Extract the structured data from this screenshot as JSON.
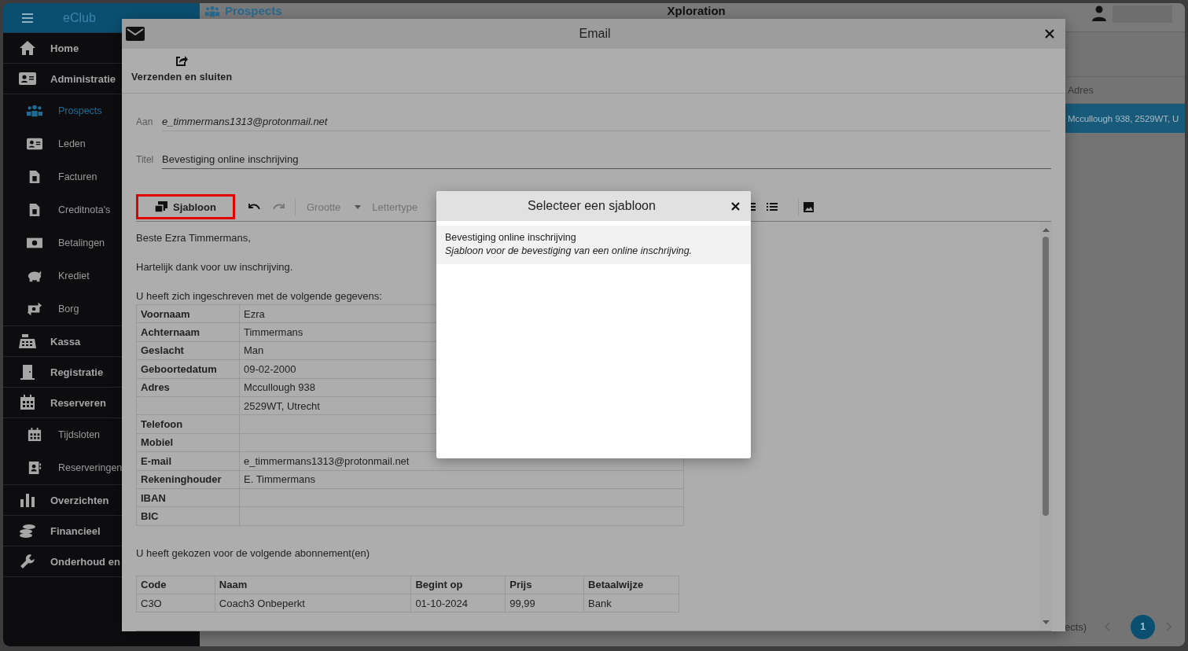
{
  "app": {
    "name": "eClub"
  },
  "sidebar": {
    "items": [
      {
        "label": "Home",
        "selected": false
      },
      {
        "label": "Administratie",
        "selected": false,
        "children": [
          {
            "label": "Prospects",
            "selected": true
          },
          {
            "label": "Leden",
            "selected": false
          },
          {
            "label": "Facturen",
            "selected": false
          },
          {
            "label": "Creditnota's",
            "selected": false
          },
          {
            "label": "Betalingen",
            "selected": false
          },
          {
            "label": "Krediet",
            "selected": false
          },
          {
            "label": "Borg",
            "selected": false
          }
        ]
      },
      {
        "label": "Kassa",
        "selected": false
      },
      {
        "label": "Registratie",
        "selected": false
      },
      {
        "label": "Reserveren",
        "selected": false,
        "children": [
          {
            "label": "Tijdsloten",
            "selected": false
          },
          {
            "label": "Reserveringen",
            "selected": false
          }
        ]
      },
      {
        "label": "Overzichten",
        "selected": false
      },
      {
        "label": "Financieel",
        "selected": false
      },
      {
        "label": "Onderhoud en",
        "selected": false
      }
    ]
  },
  "header": {
    "page_title": "Prospects",
    "club": "Xploration"
  },
  "list": {
    "column": "Adres",
    "rows": [
      {
        "adres": "Mccullough 938, 2529WT, U",
        "selected": true
      }
    ],
    "footer": "ects)",
    "page": "1"
  },
  "email_dialog": {
    "title": "Email",
    "action": "Verzenden en sluiten",
    "to_label": "Aan",
    "to": "e_timmermans1313@protonmail.net",
    "subject_label": "Titel",
    "subject": "Bevestiging online inschrijving",
    "toolbar": {
      "template_button": "Sjabloon",
      "template_highlighted": true,
      "size": "Grootte",
      "font": "Lettertype"
    },
    "body": {
      "paragraphs": [
        "Beste Ezra Timmermans,",
        "Hartelijk dank voor uw inschrijving.",
        "U heeft zich ingeschreven met de volgende gegevens:"
      ],
      "details": [
        {
          "label": "Voornaam",
          "value": "Ezra"
        },
        {
          "label": "Achternaam",
          "value": "Timmermans"
        },
        {
          "label": "Geslacht",
          "value": "Man"
        },
        {
          "label": "Geboortedatum",
          "value": "09-02-2000"
        },
        {
          "label": "Adres",
          "value": "Mccullough 938"
        },
        {
          "value": "2529WT, Utrecht"
        },
        {
          "label": "Telefoon"
        },
        {
          "label": "Mobiel"
        },
        {
          "label": "E-mail",
          "value": "e_timmermans1313@protonmail.net"
        },
        {
          "label": "Rekeninghouder",
          "value": "E. Timmermans"
        },
        {
          "label": "IBAN"
        },
        {
          "label": "BIC"
        }
      ],
      "subscriptions_intro": "U heeft gekozen voor de volgende abonnement(en)",
      "subscriptions": {
        "columns": [
          "Code",
          "Naam",
          "Begint op",
          "Prijs",
          "Betaalwijze"
        ],
        "rows": [
          [
            "C3O",
            "Coach3 Onbeperkt",
            "01-10-2024",
            "99,99",
            "Bank"
          ]
        ]
      }
    }
  },
  "template_dialog": {
    "title": "Selecteer een sjabloon",
    "templates": [
      {
        "title": "Bevestiging online inschrijving",
        "description": "Sjabloon voor de bevestiging van een online inschrijving."
      }
    ]
  }
}
